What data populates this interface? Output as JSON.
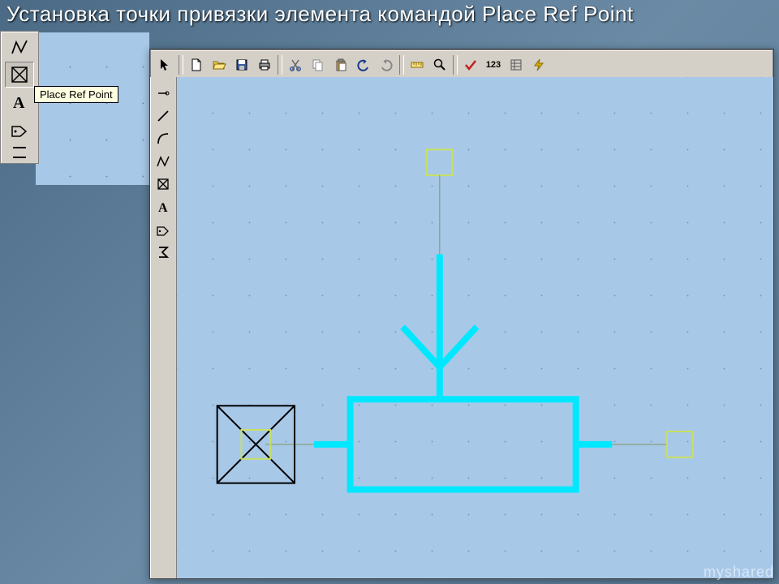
{
  "title": "Установка точки привязки элемента командой Place Ref Point",
  "tooltip": "Place Ref Point",
  "watermark": "myshared",
  "top_toolbar": {
    "arrow": "select",
    "new": "new",
    "open": "open",
    "save": "save",
    "print": "print",
    "cut": "cut",
    "copy": "copy",
    "paste": "paste",
    "undo": "undo",
    "redo": "redo",
    "ruler": "ruler",
    "zoom": "zoom",
    "check": "check",
    "num": "123",
    "opts": "options",
    "bolt": "run"
  },
  "left_small": [
    "polyline",
    "refpoint-selected",
    "text",
    "tag",
    "misc"
  ],
  "side_tools": [
    "pin",
    "line",
    "arc",
    "polyline",
    "refpoint",
    "text",
    "tag",
    "sigma"
  ]
}
